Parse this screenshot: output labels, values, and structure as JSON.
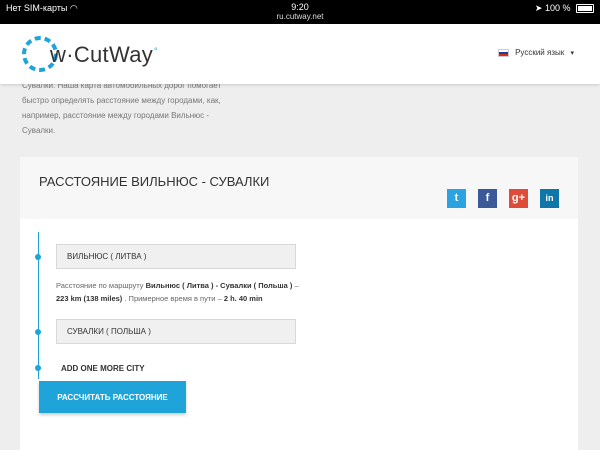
{
  "statusbar": {
    "carrier": "Нет SIM-карты",
    "time": "9:20",
    "url": "ru.cutway.net",
    "battery": "100 %"
  },
  "header": {
    "logo_text": "w·CutWay",
    "logo_sup": "°",
    "language": "Русский язык"
  },
  "intro": {
    "text": "Сувалки. Наша карта автомобильных дорог помогает быстро определять расстояние между городами, как, например, расстояние между городами Вильнюс - Сувалки."
  },
  "card": {
    "title": "РАССТОЯНИЕ ВИЛЬНЮС - СУВАЛКИ",
    "social": {
      "twitter": "t",
      "facebook": "f",
      "google": "g+",
      "linkedin": "in"
    },
    "from_city": "ВИЛЬНЮС ( ЛИТВА )",
    "to_city": "СУВАЛКИ ( ПОЛЬША )",
    "route": {
      "prefix": "Расстояние по маршруту ",
      "route_name": "Вильнюс ( Литва ) - Сувалки ( Польша )",
      "dash": " – ",
      "distance": "223 km (138 miles)",
      "time_label": " . Примерное время в пути – ",
      "time": "2 h. 40 min"
    },
    "add_city": "ADD ONE MORE CITY",
    "calc_button": "РАССЧИТАТЬ РАССТОЯНИЕ"
  },
  "colors": {
    "accent": "#1ea4d8",
    "twitter": "#2aa3e0",
    "facebook": "#3b5998",
    "google": "#dd4b39",
    "linkedin": "#0e76a8"
  }
}
